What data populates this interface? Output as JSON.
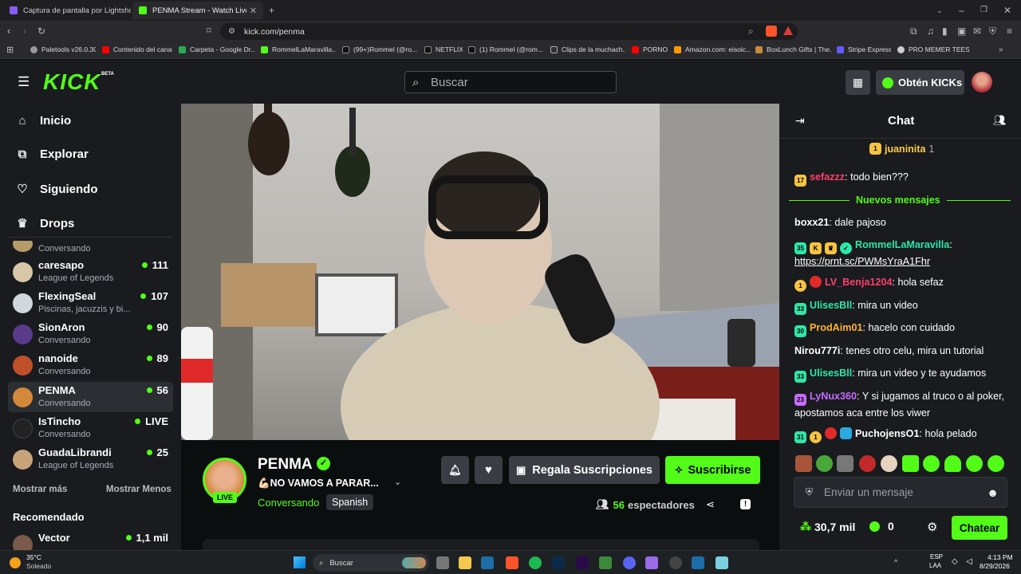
{
  "browser": {
    "tabs": [
      {
        "title": "Captura de pantalla por Lightshot"
      },
      {
        "title": "PENMA Stream - Watch Live on K"
      }
    ],
    "url": "kick.com/penma",
    "bookmarks": [
      "Paletools v26.0.30",
      "Contenido del canal",
      "Carpeta - Google Dr...",
      "RommelLaMaravilla...",
      "(99+)Rommel (@ro...",
      "NETFLIX",
      "(1) Rommel (@rom...",
      "Clips de la muchach...",
      "PORNO",
      "Amazon.com: eisoic...",
      "BoxLunch Gifts | The...",
      "Stripe Express",
      "PRO MEMER TEES"
    ]
  },
  "header": {
    "logo": "KICK",
    "logo_badge": "BETA",
    "search_placeholder": "Buscar",
    "get_kicks": "Obtén KICKs"
  },
  "sidebar": {
    "nav": [
      {
        "label": "Inicio",
        "icon": "home-icon"
      },
      {
        "label": "Explorar",
        "icon": "explore-icon"
      },
      {
        "label": "Siguiendo",
        "icon": "heart-icon"
      },
      {
        "label": "Drops",
        "icon": "drops-icon"
      }
    ],
    "partial_category": "Conversando",
    "channels": [
      {
        "name": "caresapo",
        "category": "League of Legends",
        "viewers": "111",
        "color": "#d8c8a8"
      },
      {
        "name": "FlexingSeal",
        "category": "Piscinas, jacuzzis y bi...",
        "viewers": "107",
        "color": "#cfd8dc"
      },
      {
        "name": "SionAron",
        "category": "Conversando",
        "viewers": "90",
        "color": "#5a3a8a"
      },
      {
        "name": "nanoide",
        "category": "Conversando",
        "viewers": "89",
        "color": "#c0502a"
      },
      {
        "name": "PENMA",
        "category": "Conversando",
        "viewers": "56",
        "color": "#d4883a"
      },
      {
        "name": "IsTincho",
        "category": "Conversando",
        "viewers": "LIVE",
        "color": "#222"
      },
      {
        "name": "GuadaLibrandi",
        "category": "League of Legends",
        "viewers": "25",
        "color": "#c7a47a"
      }
    ],
    "show_more": "Mostrar más",
    "show_less": "Mostrar Menos",
    "recommended_title": "Recomendado",
    "recommended": [
      {
        "name": "Vector",
        "viewers": "1,1 mil"
      }
    ]
  },
  "stream": {
    "live_badge": "LIVE",
    "channel": "PENMA",
    "title": "💪🏻NO VAMOS A PARAR...",
    "category": "Conversando",
    "language": "Spanish",
    "gift_button": "Regala Suscripciones",
    "subscribe_button": "Suscribirse",
    "viewers_count": "56",
    "viewers_label": "espectadores"
  },
  "chat": {
    "title": "Chat",
    "pinned_user": "juaninita",
    "pinned_count": "1",
    "new_messages": "Nuevos mensajes",
    "messages": [
      {
        "badges": [
          "17"
        ],
        "user": "sefazzz",
        "color": "#ff3f6b",
        "text": ": todo bien???"
      },
      {
        "badges": [],
        "user": "boxx21",
        "color": "#ffffff",
        "text": ": dale pajoso"
      },
      {
        "badges": [
          "35"
        ],
        "user": "RommelLaMaravilla",
        "color": "#2ee6a8",
        "text": ":",
        "link": "https://prnt.sc/PWMsYraA1Fhr"
      },
      {
        "badges": [
          "1"
        ],
        "user": "LV_Benja1204",
        "color": "#ff3f6b",
        "text": ": hola sefaz"
      },
      {
        "badges": [
          "33"
        ],
        "user": "UlisesBll",
        "color": "#2ee6a8",
        "text": ": mira un video"
      },
      {
        "badges": [
          "30"
        ],
        "user": "ProdAim01",
        "color": "#ffb428",
        "text": ": hacelo con cuidado"
      },
      {
        "badges": [],
        "user": "Nirou777i",
        "color": "#ffffff",
        "text": ": tenes otro celu, mira un tutorial"
      },
      {
        "badges": [
          "33"
        ],
        "user": "UlisesBll",
        "color": "#2ee6a8",
        "text": ": mira un video y te ayudamos"
      },
      {
        "badges": [
          "23"
        ],
        "user": "LyNux360",
        "color": "#c86bff",
        "text": ": Y si jugamos al truco o al poker, apostamos aca entre los viwer"
      },
      {
        "badges": [
          "31",
          "1"
        ],
        "user": "PuchojensO1",
        "color": "#ffffff",
        "text": ": hola pelado"
      }
    ],
    "input_placeholder": "Enviar un mensaje",
    "points": "30,7 mil",
    "kicks": "0",
    "send_button": "Chatear"
  },
  "taskbar": {
    "weather_temp": "35°C",
    "weather_desc": "Soleado",
    "search": "Buscar",
    "lang": "ESP",
    "lang2": "LAA",
    "time": "4:13 PM",
    "date": "8/29/2026"
  },
  "colors": {
    "kick_green": "#53fc18",
    "bg": "#0b0e0f",
    "panel": "#191b1f"
  }
}
